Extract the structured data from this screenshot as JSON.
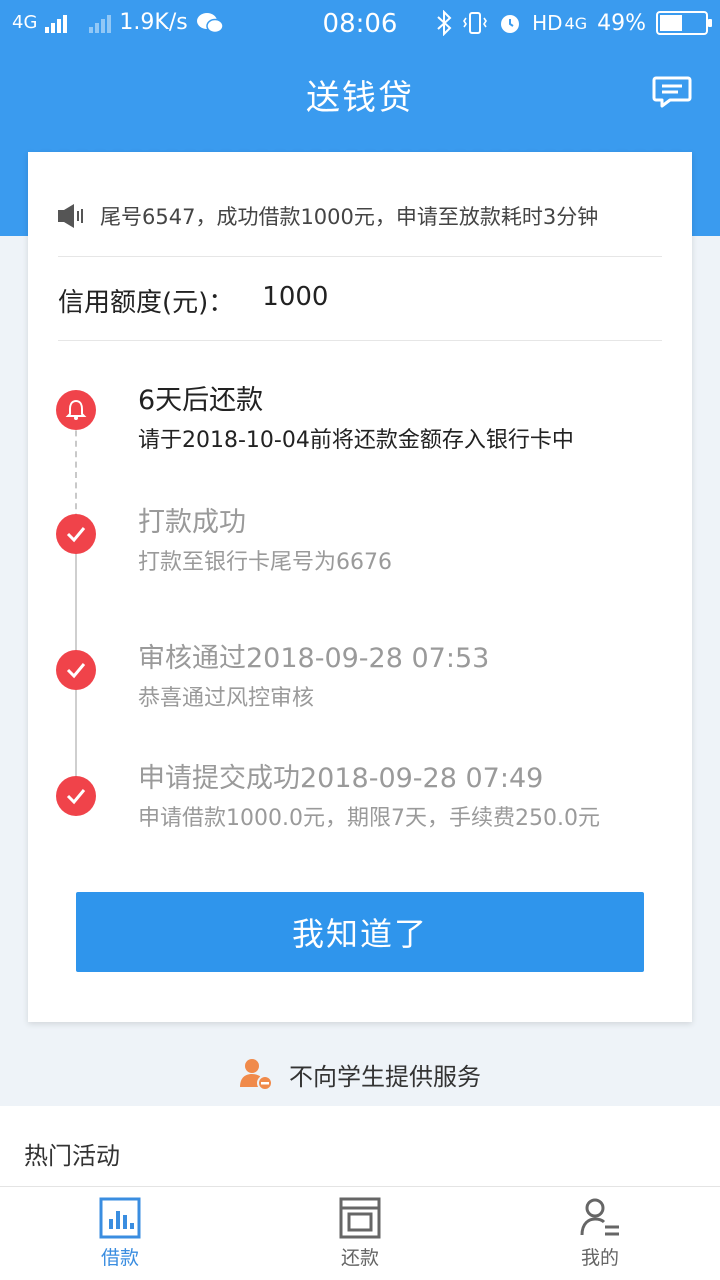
{
  "status_bar": {
    "net1": "4G",
    "speed": "1.9K/s",
    "time": "08:06",
    "hd": "HD",
    "net2": "4G",
    "battery": "49%"
  },
  "header": {
    "title": "送钱贷"
  },
  "notice": {
    "text": "尾号6547，成功借款1000元，申请至放款耗时3分钟"
  },
  "credit": {
    "label": "信用额度(元)：",
    "value": "1000"
  },
  "timeline": [
    {
      "title": "6天后还款",
      "subtitle": "请于2018-10-04前将还款金额存入银行卡中",
      "state": "active"
    },
    {
      "title": "打款成功",
      "subtitle": "打款至银行卡尾号为6676",
      "state": "done"
    },
    {
      "title": "审核通过2018-09-28 07:53",
      "subtitle": "恭喜通过风控审核",
      "state": "done"
    },
    {
      "title": "申请提交成功2018-09-28 07:49",
      "subtitle": "申请借款1000.0元，期限7天，手续费250.0元",
      "state": "done"
    }
  ],
  "button": {
    "label": "我知道了"
  },
  "no_student": {
    "text": "不向学生提供服务"
  },
  "hot": {
    "title": "热门活动"
  },
  "tabs": [
    {
      "label": "借款",
      "icon": "chart-icon",
      "active": true
    },
    {
      "label": "还款",
      "icon": "bill-icon",
      "active": false
    },
    {
      "label": "我的",
      "icon": "person-icon",
      "active": false
    }
  ],
  "colors": {
    "primary": "#3a9bef",
    "button": "#2f95ec",
    "alert": "#f0434a",
    "orange": "#f08a4b"
  }
}
